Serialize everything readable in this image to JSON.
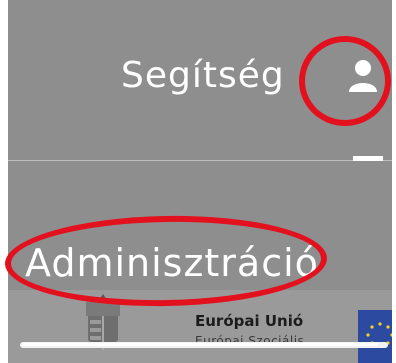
{
  "header": {
    "help_label": "Segítség",
    "user_icon": "user-icon"
  },
  "menu": {
    "admin_label": "Adminisztráció"
  },
  "footer": {
    "eu_line1": "Európai Unió",
    "eu_line2": "Európai Szociális"
  },
  "colors": {
    "panel": "#8e8e8e",
    "annotation": "#e3101d",
    "eu_blue": "#2b4aa0",
    "eu_star": "#f6d22a"
  }
}
